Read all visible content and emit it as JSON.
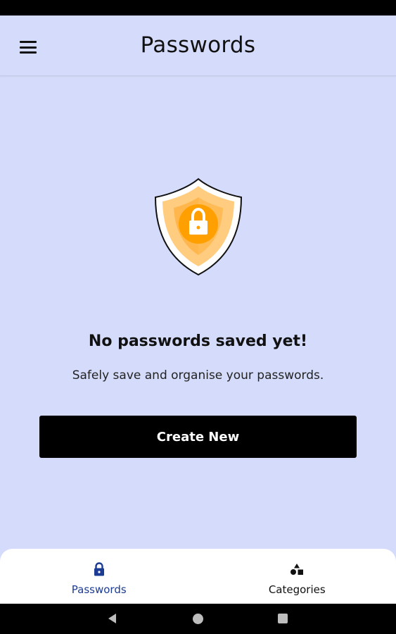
{
  "app_bar": {
    "title": "Passwords",
    "menu_icon": "hamburger-menu-icon"
  },
  "empty_state": {
    "illustration_icon": "shield-lock-icon",
    "title": "No passwords saved yet!",
    "subtitle": "Safely save and organise your passwords.",
    "create_button_label": "Create New"
  },
  "bottom_nav": {
    "items": [
      {
        "label": "Passwords",
        "icon": "lock-icon",
        "active": true
      },
      {
        "label": "Categories",
        "icon": "shapes-icon",
        "active": false
      }
    ]
  },
  "colors": {
    "background": "#d5dcfb",
    "button": "#000000",
    "nav_active": "#1c3c94",
    "shield_orange": "#ffa726",
    "shield_light": "#ffcc80"
  },
  "system_nav": {
    "back_icon": "back-triangle-icon",
    "home_icon": "home-circle-icon",
    "recents_icon": "recents-square-icon"
  }
}
